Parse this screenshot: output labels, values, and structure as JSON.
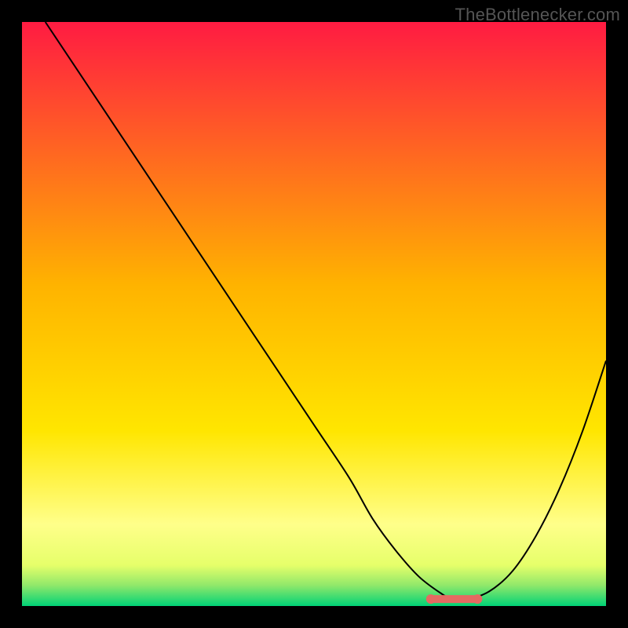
{
  "attribution": "TheBottlenecker.com",
  "colors": {
    "top": "#ff1b42",
    "mid": "#ffd400",
    "low": "#ffff7a",
    "base": "#00d277",
    "curve": "#000000",
    "marker": "#e56a62",
    "page_bg": "#000000"
  },
  "chart_data": {
    "type": "line",
    "title": "",
    "xlabel": "",
    "ylabel": "",
    "xlim": [
      0,
      100
    ],
    "ylim": [
      0,
      100
    ],
    "grid": false,
    "series": [
      {
        "name": "bottleneck-curve",
        "x": [
          4,
          10,
          20,
          30,
          40,
          50,
          56,
          60,
          64,
          68,
          72,
          74,
          76,
          80,
          84,
          88,
          92,
          96,
          100
        ],
        "y": [
          100,
          91,
          76,
          61,
          46,
          31,
          22,
          15,
          9.5,
          5,
          2,
          1,
          1,
          2.5,
          6,
          12,
          20,
          30,
          42
        ]
      }
    ],
    "markers": [
      {
        "name": "optimal-range-left",
        "x": 70,
        "y": 1.2
      },
      {
        "name": "optimal-range-right",
        "x": 78,
        "y": 1.2
      }
    ],
    "background_gradient_stops": [
      {
        "pos": 0.0,
        "color": "#ff1b42"
      },
      {
        "pos": 0.45,
        "color": "#ffb300"
      },
      {
        "pos": 0.7,
        "color": "#ffe600"
      },
      {
        "pos": 0.86,
        "color": "#ffff8a"
      },
      {
        "pos": 0.93,
        "color": "#e6ff6a"
      },
      {
        "pos": 0.965,
        "color": "#8fe86a"
      },
      {
        "pos": 1.0,
        "color": "#00d277"
      }
    ]
  }
}
